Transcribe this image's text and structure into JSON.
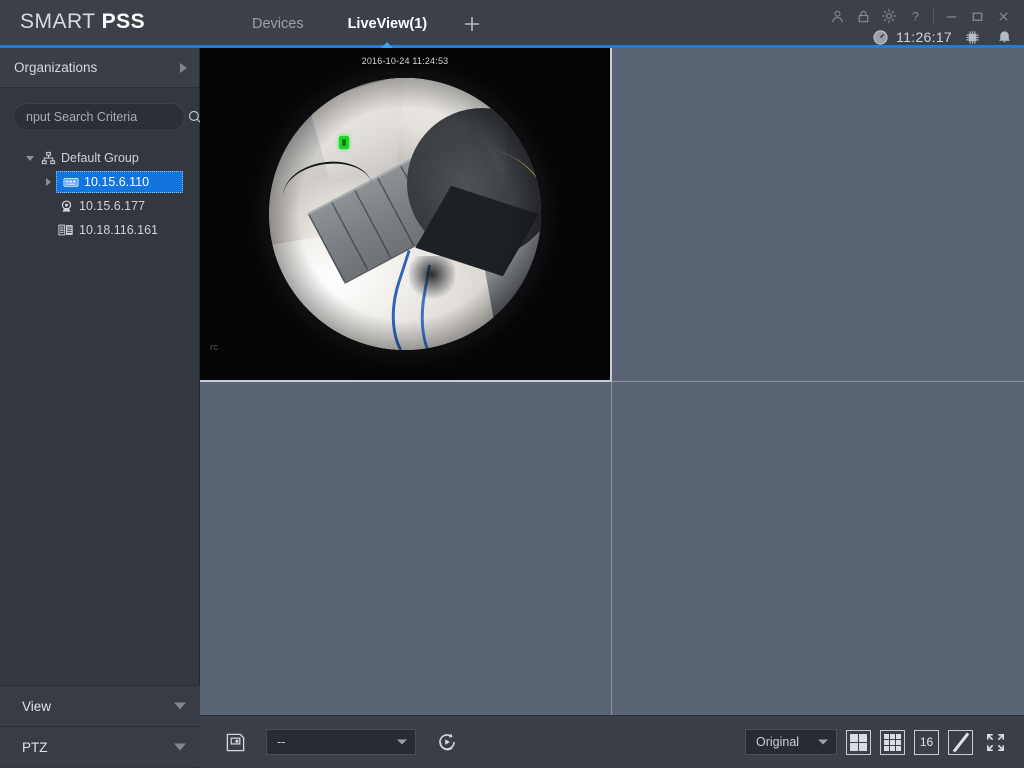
{
  "app": {
    "brand_prefix": "SMART ",
    "brand_bold": "PSS"
  },
  "titlebar": {
    "tabs": [
      {
        "label": "Devices",
        "active": false
      },
      {
        "label": "LiveView(1)",
        "active": true
      }
    ],
    "add_tab_label": "+",
    "window_icons": [
      {
        "name": "user-icon"
      },
      {
        "name": "lock-icon"
      },
      {
        "name": "gear-icon"
      },
      {
        "name": "help-icon"
      },
      {
        "name": "minimize-icon"
      },
      {
        "name": "maximize-icon"
      },
      {
        "name": "close-icon"
      }
    ],
    "clock_time": "11:26:17",
    "status_icons": [
      {
        "name": "cpu-icon"
      },
      {
        "name": "bell-icon"
      }
    ]
  },
  "sidebar": {
    "organizations_label": "Organizations",
    "search": {
      "placeholder": "nput Search Criteria",
      "value": ""
    },
    "tree": [
      {
        "label": "Default Group",
        "icon": "org-chart-icon",
        "level": 0,
        "expanded": true,
        "selected": false
      },
      {
        "label": "10.15.6.110",
        "icon": "nvr-icon",
        "level": 1,
        "expanded": false,
        "selected": true
      },
      {
        "label": "10.15.6.177",
        "icon": "dome-camera-icon",
        "level": 1,
        "expanded": null,
        "selected": false
      },
      {
        "label": "10.18.116.161",
        "icon": "server-rack-icon",
        "level": 1,
        "expanded": null,
        "selected": false
      }
    ],
    "panels": [
      {
        "label": "View"
      },
      {
        "label": "PTZ"
      }
    ]
  },
  "video": {
    "layout": "4-split",
    "cells": [
      {
        "active": true,
        "has_stream": true,
        "osd_timestamp": "2016-10-24 11:24:53",
        "osd_channel_name": "rc",
        "stream_type": "fisheye"
      },
      {
        "active": false,
        "has_stream": false
      },
      {
        "active": false,
        "has_stream": false
      },
      {
        "active": false,
        "has_stream": false
      }
    ]
  },
  "bottombar": {
    "save_button_label": "save-view",
    "stream_select": {
      "value": "--"
    },
    "refresh_button_label": "refresh-stream",
    "quality_select": {
      "value": "Original"
    },
    "layout_buttons": [
      {
        "name": "layout-4-split",
        "label": ""
      },
      {
        "name": "layout-9-split",
        "label": ""
      },
      {
        "name": "layout-16-split",
        "label": "16"
      },
      {
        "name": "layout-custom",
        "label": ""
      }
    ],
    "fullscreen_button_label": "fullscreen"
  },
  "colors": {
    "accent_blue": "#1f7fd4",
    "selection_blue": "#1275dd",
    "tab_indicator": "#3ba3ef",
    "titlebar_bg": "#3b4049",
    "sidebar_bg": "#33373e",
    "empty_cell_bg": "#5b6475",
    "status_green": "#22d32a"
  }
}
